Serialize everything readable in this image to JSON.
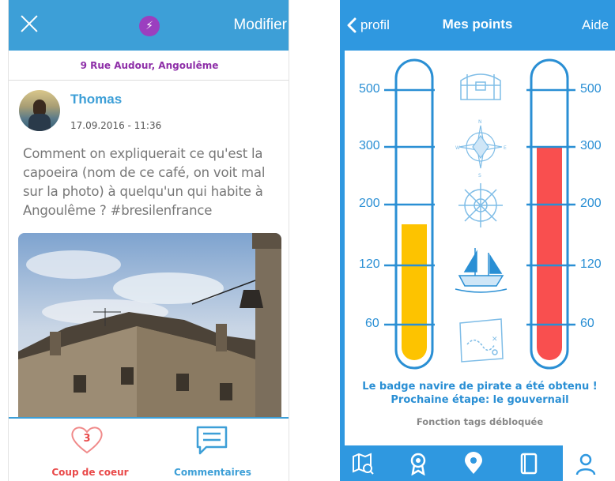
{
  "left_screen": {
    "navbar": {
      "close_icon": "close-x-icon",
      "badge_icon": "lightning-bolt-icon",
      "badge_color": "#9b3fbf",
      "edit_label": "Modifier"
    },
    "address": "9 Rue Audour, Angoulême",
    "post": {
      "author": "Thomas",
      "date": "17.09.2016 - 11:36",
      "text": "Comment on expliquerait ce qu'est la capoeira (nom de ce café, on voit mal sur la photo) à quelqu'un qui habite à Angoulême ? #bresilenfrance"
    },
    "actions": {
      "like_count": "3",
      "like_label": "Coup de coeur",
      "comment_label": "Commentaires"
    },
    "colors": {
      "accent": "#3d9fd7",
      "like": "#e94949",
      "address": "#8e2fa8"
    }
  },
  "right_screen": {
    "navbar": {
      "back_label": "profil",
      "title": "Mes points",
      "help_label": "Aide"
    },
    "scale_left": [
      "500",
      "300",
      "200",
      "120",
      "60"
    ],
    "scale_right": [
      "500",
      "300",
      "200",
      "120",
      "60"
    ],
    "badges": [
      "treasure-chest-icon",
      "compass-rose-icon",
      "ship-wheel-icon",
      "pirate-ship-icon",
      "treasure-map-icon"
    ],
    "thermometer_left": {
      "color": "#fdc300",
      "level": 180
    },
    "thermometer_right": {
      "color": "#f94f4f",
      "level": 300
    },
    "message_line1": "Le badge navire de pirate a été obtenu !",
    "message_line2": "Prochaine étape: le gouvernail",
    "unlocked": "Fonction tags débloquée",
    "tabs": [
      "map-icon",
      "award-ribbon-icon",
      "location-pin-icon",
      "book-icon",
      "profile-icon"
    ],
    "colors": {
      "accent": "#2f98e0",
      "line": "#2a8fd4"
    }
  }
}
